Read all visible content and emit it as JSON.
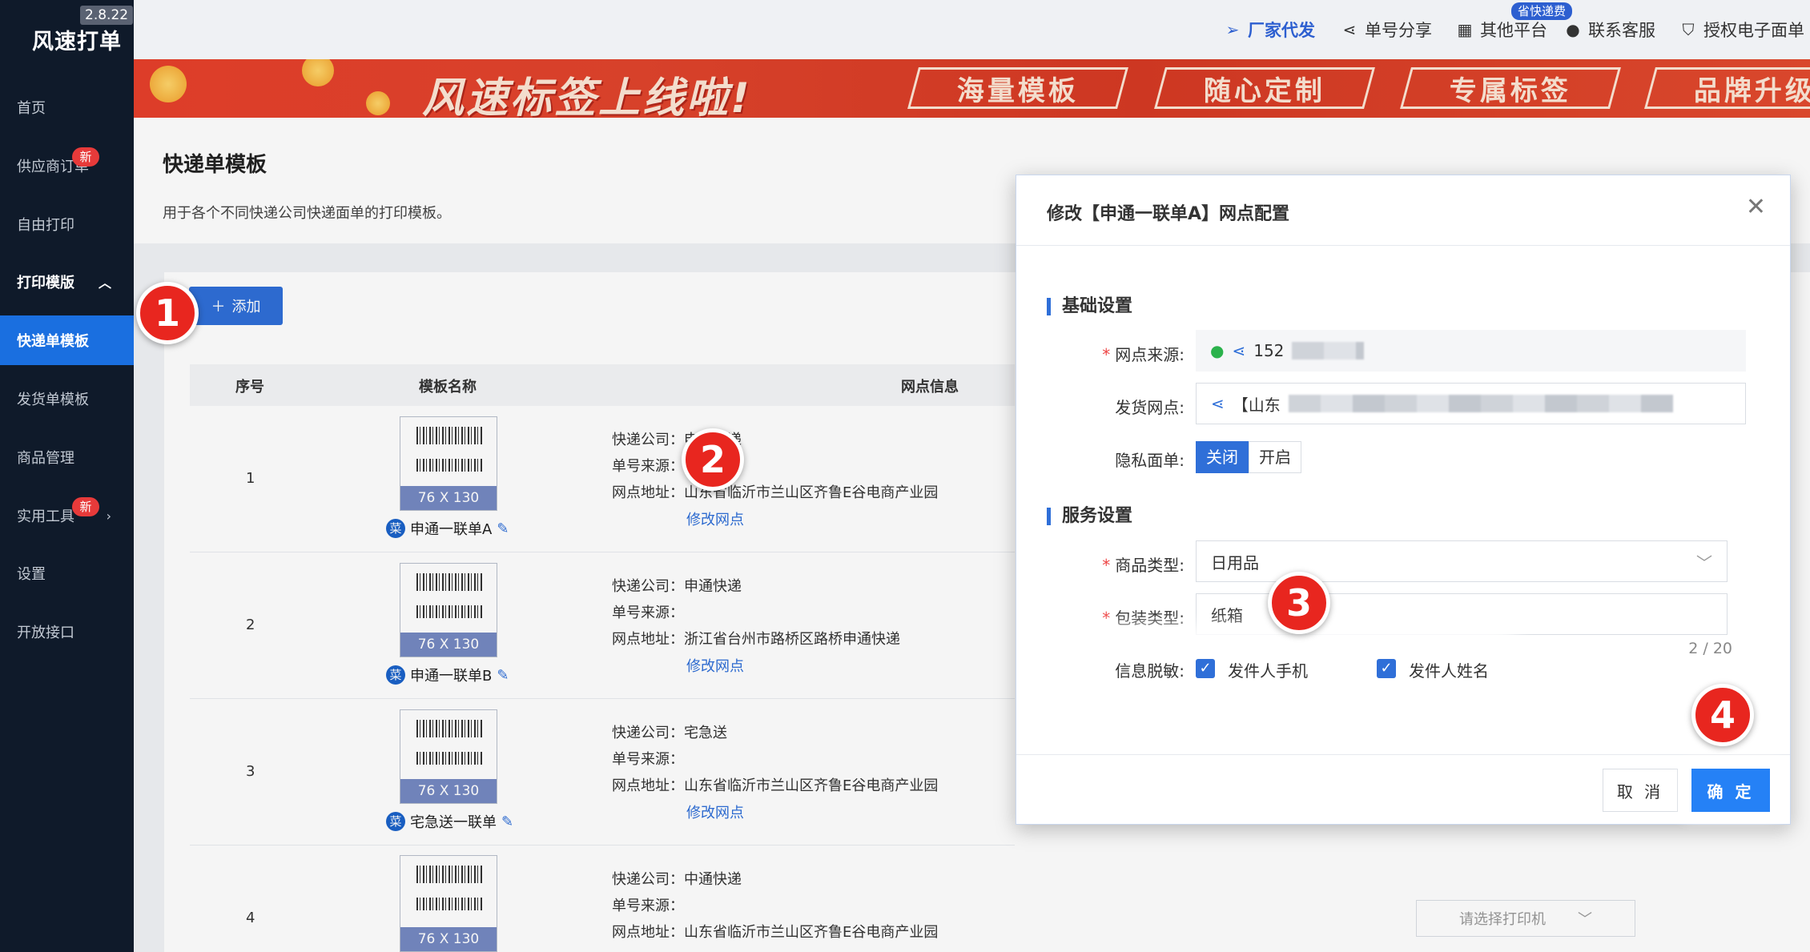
{
  "app": {
    "name": "风速打单",
    "version": "2.8.22"
  },
  "sidebar": {
    "items": [
      {
        "label": "首页"
      },
      {
        "label": "供应商订单",
        "badge": "新"
      },
      {
        "label": "自由打印"
      },
      {
        "label": "打印模版"
      },
      {
        "label": "快递单模板"
      },
      {
        "label": "发货单模板"
      },
      {
        "label": "商品管理"
      },
      {
        "label": "实用工具",
        "badge": "新"
      },
      {
        "label": "设置"
      },
      {
        "label": "开放接口"
      }
    ]
  },
  "topbar": {
    "links": [
      {
        "label": "厂家代发",
        "icon": "send-icon"
      },
      {
        "label": "单号分享",
        "icon": "share-icon",
        "badge": "省快递费"
      },
      {
        "label": "其他平台",
        "icon": "grid-icon"
      },
      {
        "label": "联系客服",
        "icon": "support-icon"
      },
      {
        "label": "授权电子面单",
        "icon": "shield-icon"
      }
    ]
  },
  "banner": {
    "title": "风速标签上线啦!",
    "tags": [
      "海量模板",
      "随心定制",
      "专属标签",
      "品牌升级"
    ]
  },
  "page": {
    "title": "快递单模板",
    "desc": "用于各个不同快递公司快递面单的打印模板。",
    "add_button": "添加"
  },
  "table": {
    "headers": [
      "序号",
      "模板名称",
      "网点信息"
    ],
    "info_labels": {
      "company": "快递公司：",
      "source": "单号来源：",
      "address": "网点地址："
    },
    "modify_link": "修改网点",
    "thumb_size": "76 X 130",
    "cai_glyph": "菜",
    "rows": [
      {
        "num": "1",
        "name": "申通一联单A",
        "company": "申通快递",
        "source": "",
        "address": "山东省临沂市兰山区齐鲁E谷电商产业园"
      },
      {
        "num": "2",
        "name": "申通一联单B",
        "company": "申通快递",
        "source": "",
        "address": "浙江省台州市路桥区路桥申通快递"
      },
      {
        "num": "3",
        "name": "宅急送一联单",
        "company": "宅急送",
        "source": "",
        "address": "山东省临沂市兰山区齐鲁E谷电商产业园"
      },
      {
        "num": "4",
        "name": "",
        "company": "中通快递",
        "source": "",
        "address": "山东省临沂市兰山区齐鲁E谷电商产业园"
      }
    ]
  },
  "printer_select": {
    "placeholder": "请选择打印机"
  },
  "modal": {
    "title": "修改【申通一联单A】网点配置",
    "basic_section": "基础设置",
    "service_section": "服务设置",
    "source_label": "网点来源:",
    "source_value": "152",
    "ship_label": "发货网点:",
    "ship_value": "【山东",
    "privacy_label": "隐私面单:",
    "privacy_options": [
      "关闭",
      "开启"
    ],
    "goods_label": "商品类型:",
    "goods_value": "日用品",
    "pack_label": "包装类型:",
    "pack_value": "纸箱",
    "pack_counter": "2 / 20",
    "mask_label": "信息脱敏:",
    "mask_options": [
      "发件人手机",
      "发件人姓名"
    ],
    "cancel": "取 消",
    "ok": "确 定"
  },
  "steps": [
    "1",
    "2",
    "3",
    "4"
  ],
  "colors": {
    "primary": "#2f6fd8",
    "sidebar_bg": "#0f1a2a",
    "banner_red": "#e0442c",
    "step_red": "#e8261f"
  }
}
